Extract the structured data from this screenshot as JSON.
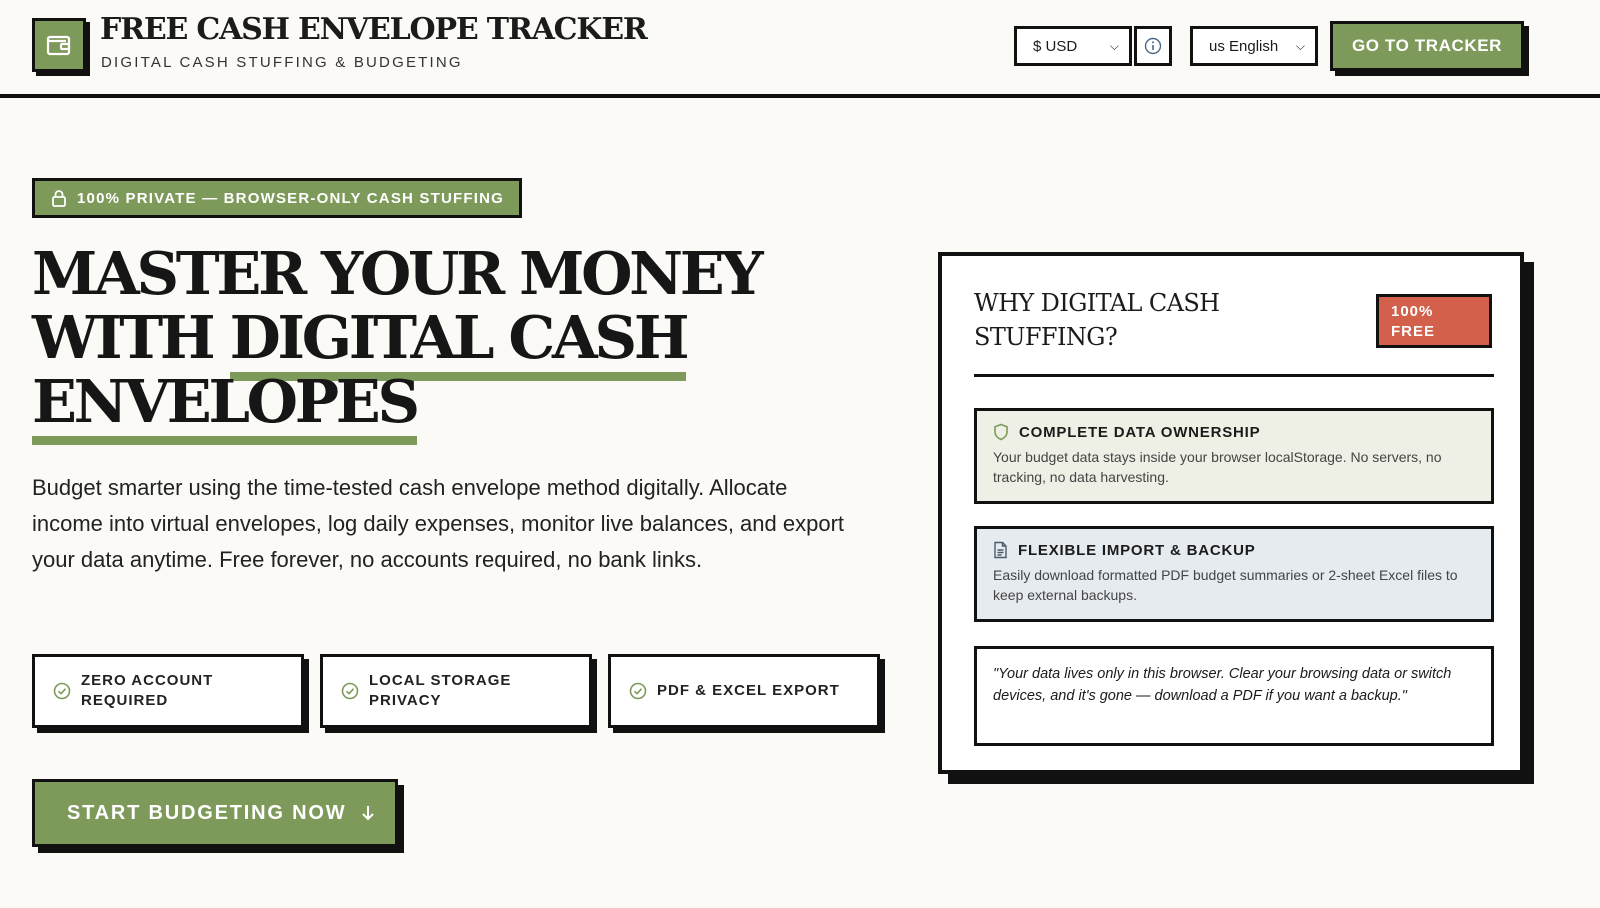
{
  "header": {
    "title": "FREE CASH ENVELOPE TRACKER",
    "subtitle": "DIGITAL CASH STUFFING & BUDGETING",
    "currency_select": "$ USD",
    "language_select": "us English",
    "cta_label": "GO TO TRACKER"
  },
  "hero": {
    "badge": "100% PRIVATE — BROWSER-ONLY CASH STUFFING",
    "headline_line1": "MASTER YOUR MONEY",
    "headline_line2_plain": "WITH ",
    "headline_line2_emph": "DIGITAL CASH",
    "headline_line3_emph": "ENVELOPES",
    "lead": "Budget smarter using the time-tested cash envelope method digitally. Allocate income into virtual envelopes, log daily expenses, monitor live balances, and export your data anytime. Free forever, no accounts required, no bank links.",
    "features": [
      {
        "label": "ZERO ACCOUNT REQUIRED"
      },
      {
        "label": "LOCAL STORAGE PRIVACY"
      },
      {
        "label": "PDF & EXCEL EXPORT"
      }
    ],
    "start_label": "START BUDGETING NOW"
  },
  "card": {
    "title": "WHY DIGITAL CASH STUFFING?",
    "badge": "100% FREE",
    "panels": [
      {
        "title": "COMPLETE DATA OWNERSHIP",
        "body": "Your budget data stays inside your browser localStorage. No servers, no tracking, no data harvesting.",
        "icon": "shield-icon"
      },
      {
        "title": "FLEXIBLE IMPORT & BACKUP",
        "body": "Easily download formatted PDF budget summaries or 2-sheet Excel files to keep external backups.",
        "icon": "document-icon"
      }
    ],
    "quote": "\"Your data lives only in this browser. Clear your browsing data or switch devices, and it's gone — download a PDF if you want a backup.\""
  },
  "colors": {
    "accent_green": "#7e9a5a",
    "accent_red": "#d2604a",
    "panel_green": "#eef0e6",
    "panel_blue": "#e6ebf0",
    "background": "#fbfaf6"
  }
}
